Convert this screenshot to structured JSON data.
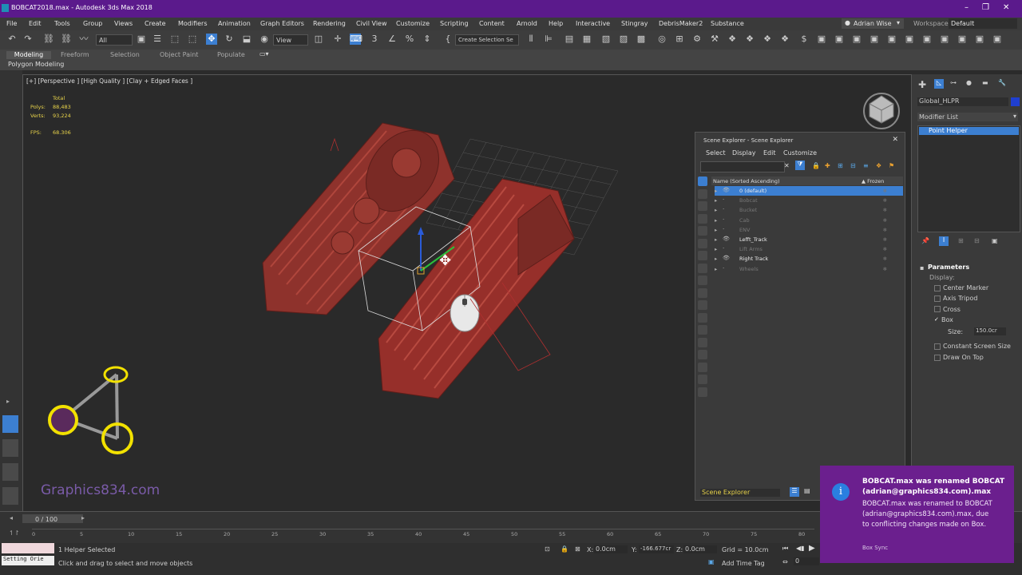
{
  "window": {
    "title": "BOBCAT2018.max - Autodesk 3ds Max 2018"
  },
  "menu": [
    "File",
    "Edit",
    "Tools",
    "Group",
    "Views",
    "Create",
    "Modifiers",
    "Animation",
    "Graph Editors",
    "Rendering",
    "Civil View",
    "Customize",
    "Scripting",
    "Content",
    "Arnold",
    "Help",
    "Interactive",
    "Stingray",
    "DebrisMaker2",
    "Substance"
  ],
  "user": {
    "name": "Adrian Wise",
    "workspaces_label": "Workspaces:",
    "workspace": "Default"
  },
  "toolbar": {
    "filter": "All",
    "view": "View",
    "selection_set": "Create Selection Se"
  },
  "ribbon": {
    "tabs": [
      "Modeling",
      "Freeform",
      "Selection",
      "Object Paint",
      "Populate"
    ],
    "sub": "Polygon Modeling"
  },
  "viewport": {
    "label": "[+] [Perspective ] [High Quality ] [Clay + Edged Faces ]",
    "total_label": "Total",
    "polys_label": "Polys:",
    "polys": "88,483",
    "verts_label": "Verts:",
    "verts": "93,224",
    "fps_label": "FPS:",
    "fps": "68.306",
    "watermark": "Graphics834.com"
  },
  "scene_explorer": {
    "title": "Scene Explorer - Scene Explorer",
    "menu": [
      "Select",
      "Display",
      "Edit",
      "Customize"
    ],
    "col_name": "Name (Sorted Ascending)",
    "col_frozen": "▲ Frozen",
    "rows": [
      {
        "name": "0 (default)",
        "state": "selected"
      },
      {
        "name": "Bobcat",
        "state": "dim"
      },
      {
        "name": "Bucket",
        "state": "dim"
      },
      {
        "name": "Cab",
        "state": "dim"
      },
      {
        "name": "ENV",
        "state": "dim"
      },
      {
        "name": "Lefft_Track",
        "state": "visible"
      },
      {
        "name": "Lift Arms",
        "state": "dim"
      },
      {
        "name": "Right Track",
        "state": "visible"
      },
      {
        "name": "Wheels",
        "state": "dim"
      }
    ],
    "footer": "Scene Explorer"
  },
  "command_panel": {
    "object_name": "Global_HLPR",
    "modifier_list": "Modifier List",
    "stack_item": "Point Helper",
    "rollout": "Parameters",
    "display_label": "Display:",
    "options": [
      {
        "label": "Center Marker",
        "checked": false
      },
      {
        "label": "Axis Tripod",
        "checked": false
      },
      {
        "label": "Cross",
        "checked": false
      },
      {
        "label": "Box",
        "checked": true
      }
    ],
    "size_label": "Size:",
    "size": "150.0cr",
    "options2": [
      {
        "label": "Constant Screen Size",
        "checked": false
      },
      {
        "label": "Draw On Top",
        "checked": false
      }
    ]
  },
  "timeline": {
    "frame": "0 / 100",
    "ticks": [
      "0",
      "5",
      "10",
      "15",
      "20",
      "25",
      "30",
      "35",
      "40",
      "45",
      "50",
      "55",
      "60",
      "65",
      "70",
      "75",
      "80"
    ]
  },
  "status": {
    "script_box": "Setting Orie",
    "selected": "1 Helper Selected",
    "prompt": "Click and drag to select and move objects",
    "x_label": "X:",
    "x": "0.0cm",
    "y_label": "Y:",
    "y": "-166.677cr",
    "z_label": "Z:",
    "z": "0.0cm",
    "grid": "Grid = 10.0cm",
    "add_time_tag": "Add Time Tag",
    "frame_value": "0"
  },
  "notification": {
    "title": "BOBCAT.max was renamed BOBCAT (adrian@graphics834.com).max",
    "body": "BOBCAT.max was renamed to BOBCAT (adrian@graphics834.com).max, due to conflicting changes made on Box.",
    "source": "Box Sync"
  },
  "colors": {
    "title_bar": "#5b1a8c",
    "notification": "#6b1f8e",
    "accent": "#3c7fd1",
    "highlight": "#e8d34a",
    "model": "#9a3a32"
  }
}
